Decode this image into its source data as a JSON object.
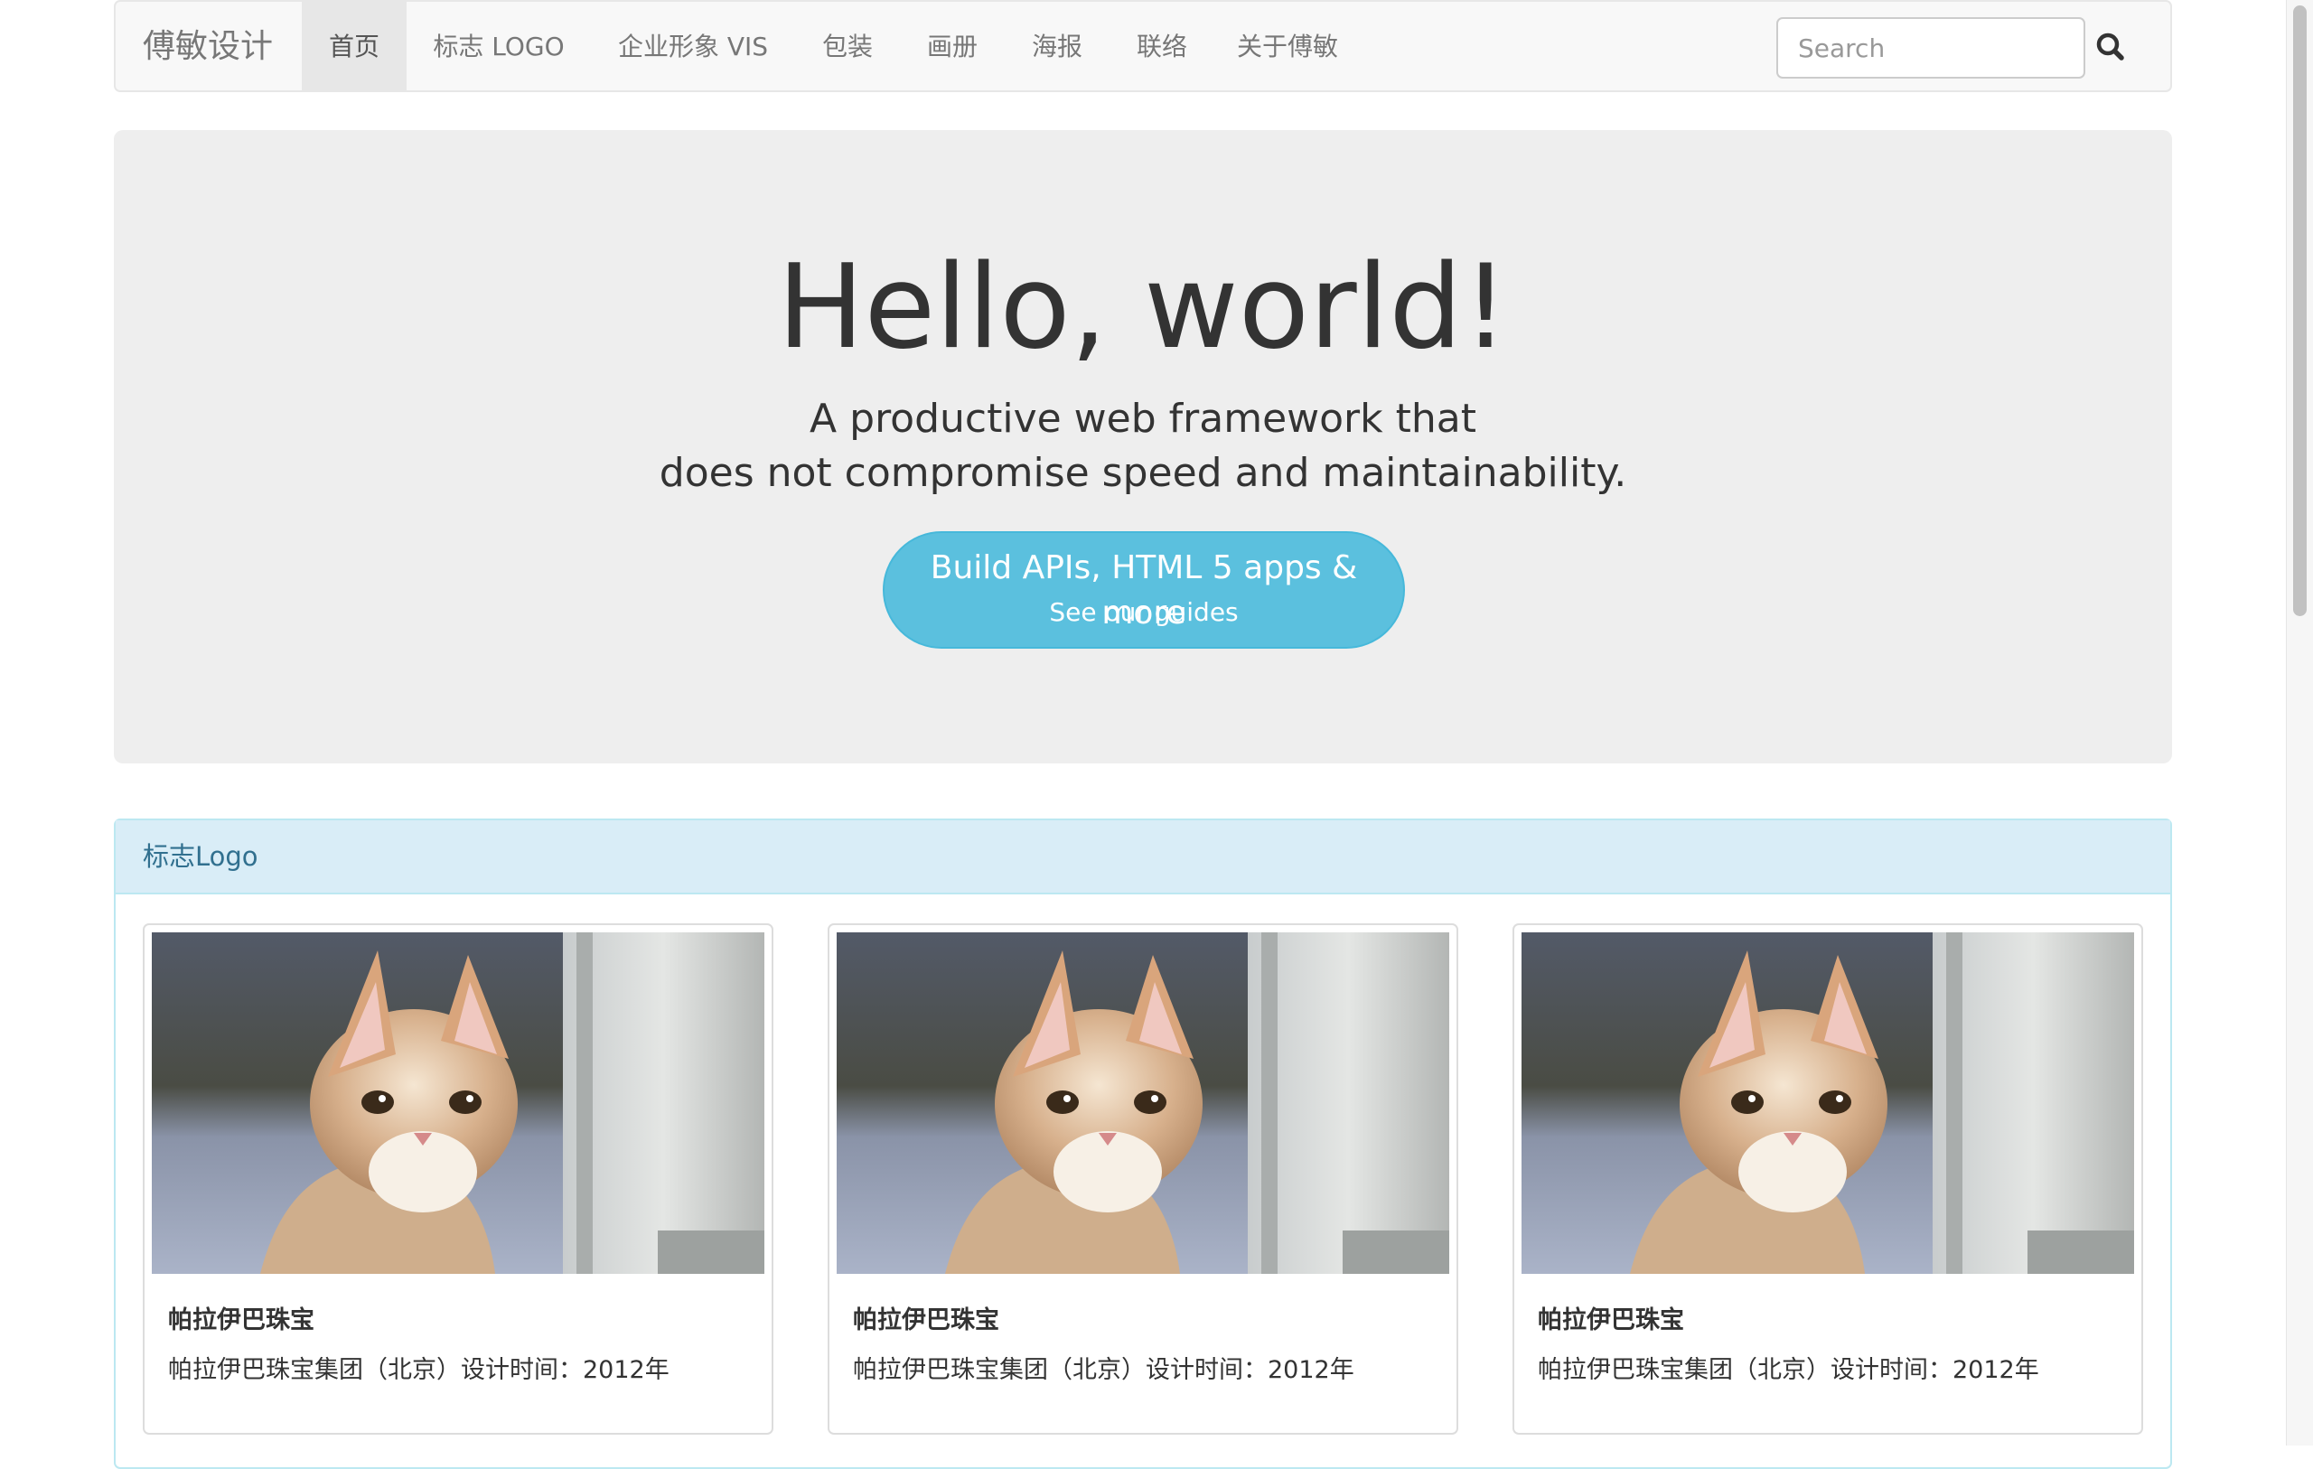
{
  "navbar": {
    "brand": "傅敏设计",
    "items": [
      {
        "label": "首页",
        "active": true
      },
      {
        "label": "标志 LOGO",
        "active": false
      },
      {
        "label": "企业形象 VIS",
        "active": false
      },
      {
        "label": "包装",
        "active": false
      },
      {
        "label": "画册",
        "active": false
      },
      {
        "label": "海报",
        "active": false
      },
      {
        "label": "联络",
        "active": false
      },
      {
        "label": "关于傅敏",
        "active": false
      }
    ],
    "search_placeholder": "Search",
    "search_icon": "search-icon"
  },
  "hero": {
    "title": "Hello, world!",
    "line1": "A productive web framework that",
    "line2": "does not compromise speed and maintainability.",
    "button_main": "Build APIs, HTML 5 apps & more",
    "button_sub": "See our guides"
  },
  "panel": {
    "heading": "标志Logo",
    "items": [
      {
        "title": "帕拉伊巴珠宝",
        "desc": "帕拉伊巴珠宝集团（北京）设计时间：2012年"
      },
      {
        "title": "帕拉伊巴珠宝",
        "desc": "帕拉伊巴珠宝集团（北京）设计时间：2012年"
      },
      {
        "title": "帕拉伊巴珠宝",
        "desc": "帕拉伊巴珠宝集团（北京）设计时间：2012年"
      }
    ]
  },
  "colors": {
    "navbar_bg": "#f8f8f8",
    "jumbotron_bg": "#eeeeee",
    "info_button": "#5bc0de",
    "panel_heading_bg": "#d9edf7",
    "panel_heading_text": "#31708f"
  }
}
